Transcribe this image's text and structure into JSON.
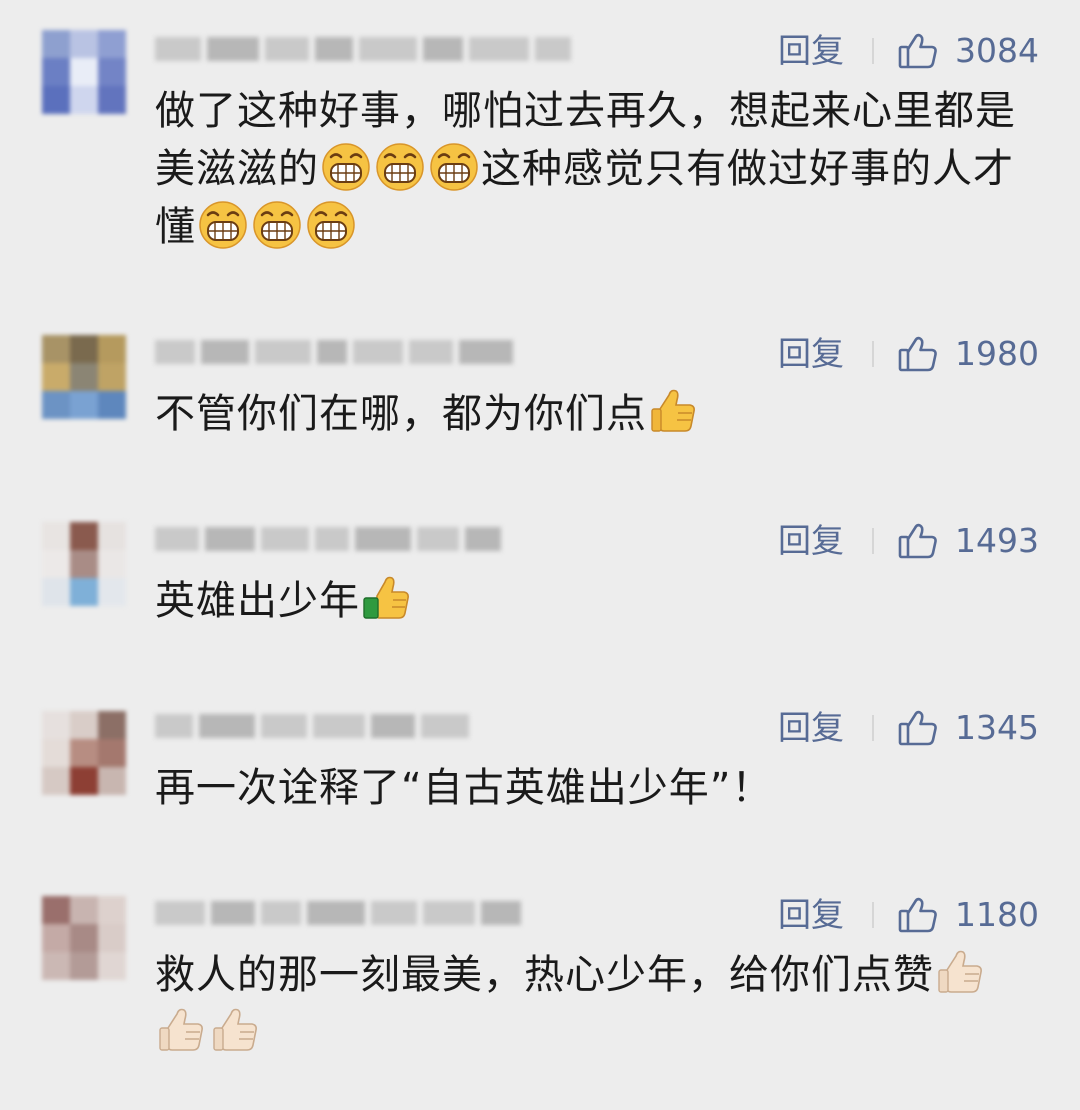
{
  "comments": [
    {
      "reply_label": "回复",
      "likes": "3084",
      "segments": [
        {
          "t": "text",
          "v": "做了这种好事，哪怕过去再久，想起来心里都是美滋滋的"
        },
        {
          "t": "emoji",
          "v": "grin"
        },
        {
          "t": "emoji",
          "v": "grin"
        },
        {
          "t": "emoji",
          "v": "grin"
        },
        {
          "t": "text",
          "v": "这种感觉只有做过好事的人才懂"
        },
        {
          "t": "emoji",
          "v": "grin"
        },
        {
          "t": "emoji",
          "v": "grin"
        },
        {
          "t": "emoji",
          "v": "grin"
        }
      ]
    },
    {
      "reply_label": "回复",
      "likes": "1980",
      "segments": [
        {
          "t": "text",
          "v": "不管你们在哪，都为你们点"
        },
        {
          "t": "emoji",
          "v": "thumbs-up-yellow"
        }
      ]
    },
    {
      "reply_label": "回复",
      "likes": "1493",
      "segments": [
        {
          "t": "text",
          "v": "英雄出少年"
        },
        {
          "t": "emoji",
          "v": "thumbs-up-cuff"
        }
      ]
    },
    {
      "reply_label": "回复",
      "likes": "1345",
      "segments": [
        {
          "t": "text",
          "v": "再一次诠释了“自古英雄出少年”！"
        }
      ]
    },
    {
      "reply_label": "回复",
      "likes": "1180",
      "segments": [
        {
          "t": "text",
          "v": "救人的那一刻最美，热心少年，给你们点赞"
        },
        {
          "t": "emoji",
          "v": "thumbs-up-light"
        },
        {
          "t": "emoji",
          "v": "thumbs-up-light"
        },
        {
          "t": "emoji",
          "v": "thumbs-up-light"
        }
      ]
    }
  ],
  "colors": {
    "background": "#ededed",
    "link": "#576b95",
    "text": "#1a1a1a"
  }
}
